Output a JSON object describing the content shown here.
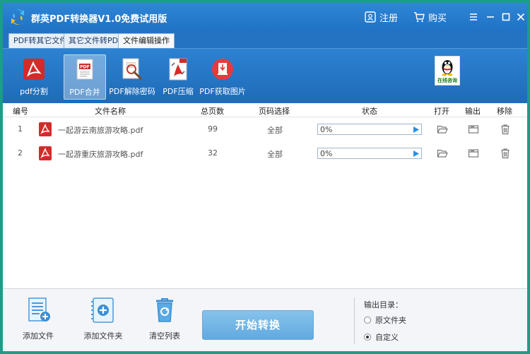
{
  "titlebar": {
    "title": "群英PDF转换器V1.0免费试用版",
    "register_label": "注册",
    "buy_label": "购买"
  },
  "tabs": [
    {
      "label": "PDF转其它文件",
      "active": false
    },
    {
      "label": "其它文件转PDF",
      "active": false
    },
    {
      "label": "文件编辑操作",
      "active": true
    }
  ],
  "toolbar": {
    "items": [
      {
        "label": "pdf分割",
        "icon": "pdf-split-icon",
        "active": false
      },
      {
        "label": "PDF合并",
        "icon": "pdf-merge-icon",
        "active": true
      },
      {
        "label": "PDF解除密码",
        "icon": "pdf-unlock-icon",
        "active": false
      },
      {
        "label": "PDF压缩",
        "icon": "pdf-compress-icon",
        "active": false
      },
      {
        "label": "PDF获取图片",
        "icon": "pdf-extract-image-icon",
        "active": false
      }
    ],
    "qq_label": "在线咨询"
  },
  "table": {
    "headers": [
      "编号",
      "文件名称",
      "总页数",
      "页码选择",
      "状态",
      "打开",
      "输出",
      "移除"
    ],
    "rows": [
      {
        "index": "1",
        "filename": "一起游云南旅游攻略.pdf",
        "pages": "99",
        "page_select": "全部",
        "progress_text": "0%",
        "progress": 0
      },
      {
        "index": "2",
        "filename": "一起游重庆旅游攻略.pdf",
        "pages": "32",
        "page_select": "全部",
        "progress_text": "0%",
        "progress": 0
      }
    ]
  },
  "bottom": {
    "add_file_label": "添加文件",
    "add_folder_label": "添加文件夹",
    "clear_list_label": "清空列表",
    "start_label": "开始转换",
    "output_dir_label": "输出目录：",
    "option_source_label": "原文件夹",
    "option_custom_label": "自定义",
    "selected_option": "custom"
  },
  "colors": {
    "frame": "#1a9e86",
    "header_blue": "#2473c2",
    "start_button": "#6eb2e4",
    "pdf_red": "#d42a2a"
  }
}
